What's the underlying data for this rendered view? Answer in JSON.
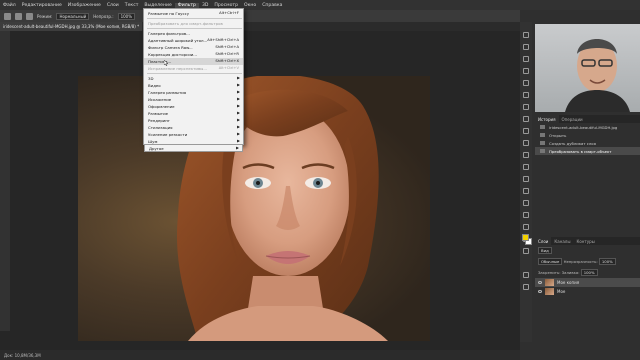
{
  "menubar": {
    "items": [
      "Файл",
      "Редактирование",
      "Изображение",
      "Слои",
      "Текст",
      "Выделение",
      "Фильтр",
      "3D",
      "Просмотр",
      "Окно",
      "Справка"
    ],
    "active_index": 6
  },
  "options": {
    "mode_label": "Режим:",
    "mode_value": "Нормальный",
    "opacity_label": "Непрозр.:",
    "opacity_value": "100%"
  },
  "document_tab": {
    "title": "iridescent-adult-beautiful-MGDH.jpg @ 33,3% (Мое копия, RGB/8) *"
  },
  "status": {
    "text": "Док: 10,8M/36,3M"
  },
  "filter_menu": {
    "items": [
      {
        "label": "Размытие по Гауссу",
        "shortcut": "Alt+Ctrl+F",
        "arrow": ""
      },
      {
        "label": "Преобразовать для смарт-фильтров",
        "shortcut": "",
        "arrow": "",
        "disabled": true
      },
      {
        "label": "Галерея фильтров...",
        "shortcut": "",
        "arrow": ""
      },
      {
        "label": "Адаптивный широкий угол...",
        "shortcut": "Alt+Shift+Ctrl+A",
        "arrow": ""
      },
      {
        "label": "Фильтр Camera Raw...",
        "shortcut": "Shift+Ctrl+A",
        "arrow": ""
      },
      {
        "label": "Коррекция дисторсии...",
        "shortcut": "Shift+Ctrl+R",
        "arrow": ""
      },
      {
        "label": "Пластика...",
        "shortcut": "Shift+Ctrl+X",
        "arrow": "",
        "highlight": true
      },
      {
        "label": "Исправление перспективы...",
        "shortcut": "Alt+Ctrl+V",
        "arrow": "",
        "disabled": true
      },
      {
        "label": "3D",
        "shortcut": "",
        "arrow": "▶"
      },
      {
        "label": "Видео",
        "shortcut": "",
        "arrow": "▶"
      },
      {
        "label": "Галерея размытия",
        "shortcut": "",
        "arrow": "▶"
      },
      {
        "label": "Искажение",
        "shortcut": "",
        "arrow": "▶"
      },
      {
        "label": "Оформление",
        "shortcut": "",
        "arrow": "▶"
      },
      {
        "label": "Размытие",
        "shortcut": "",
        "arrow": "▶"
      },
      {
        "label": "Рендеринг",
        "shortcut": "",
        "arrow": "▶"
      },
      {
        "label": "Стилизация",
        "shortcut": "",
        "arrow": "▶"
      },
      {
        "label": "Усиление резкости",
        "shortcut": "",
        "arrow": "▶"
      },
      {
        "label": "Шум",
        "shortcut": "",
        "arrow": "▶"
      },
      {
        "label": "Другое",
        "shortcut": "",
        "arrow": "▶"
      }
    ]
  },
  "history_panel": {
    "tabs": [
      "История",
      "Операции"
    ],
    "snapshot": "iridescent-adult-beautiful-MGDH.jpg",
    "rows": [
      "Открыть",
      "Создать дубликат слоя",
      "Преобразовать в смарт-объект"
    ]
  },
  "layers_panel": {
    "tabs": [
      "Слои",
      "Каналы",
      "Контуры"
    ],
    "kind_label": "Вид",
    "blend_mode": "Обычные",
    "opacity_label": "Непрозрачность:",
    "opacity_value": "100%",
    "lock_label": "Закрепить:",
    "fill_label": "Заливка:",
    "fill_value": "100%",
    "layers": [
      {
        "name": "Мое копия",
        "selected": true
      },
      {
        "name": "Мое",
        "selected": false
      }
    ]
  },
  "colors": {
    "foreground": "#f5d300",
    "background": "#ffffff",
    "menu_bg": "#f2f2f2",
    "ui_dark": "#262626"
  }
}
